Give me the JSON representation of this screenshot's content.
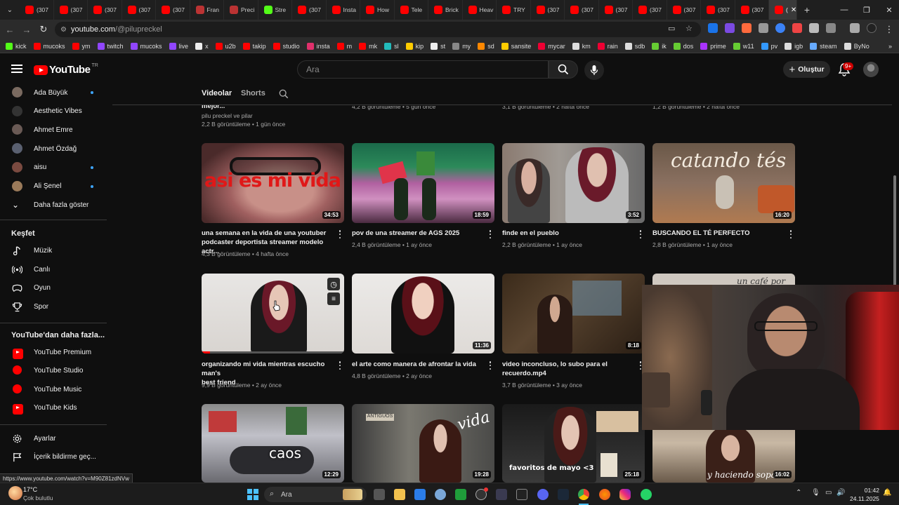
{
  "browser": {
    "tabs": [
      {
        "label": "(307",
        "color": "#ff0000"
      },
      {
        "label": "(307",
        "color": "#ff0000"
      },
      {
        "label": "(307",
        "color": "#ff0000"
      },
      {
        "label": "(307",
        "color": "#ff0000"
      },
      {
        "label": "(307",
        "color": "#ff0000"
      },
      {
        "label": "Fran",
        "color": "#b33"
      },
      {
        "label": "Preci",
        "color": "#b33"
      },
      {
        "label": "Stre",
        "color": "#53fc18"
      },
      {
        "label": "(307",
        "color": "#ff0000"
      },
      {
        "label": "Insta",
        "color": "#ff0000"
      },
      {
        "label": "How",
        "color": "#ff0000"
      },
      {
        "label": "Tele",
        "color": "#ff0000"
      },
      {
        "label": "Brick",
        "color": "#ff0000"
      },
      {
        "label": "Heav",
        "color": "#ff0000"
      },
      {
        "label": "TRY",
        "color": "#ff0000"
      },
      {
        "label": "(307",
        "color": "#ff0000"
      },
      {
        "label": "(307",
        "color": "#ff0000"
      },
      {
        "label": "(307",
        "color": "#ff0000"
      },
      {
        "label": "(307",
        "color": "#ff0000"
      },
      {
        "label": "(307",
        "color": "#ff0000"
      },
      {
        "label": "(307",
        "color": "#ff0000"
      },
      {
        "label": "(307",
        "color": "#ff0000"
      }
    ],
    "active_tab": {
      "label": "(",
      "close": "✕"
    },
    "new_tab": "+",
    "url_host": "youtube.com",
    "url_path": "/@pilupreckel",
    "bookmarks": [
      {
        "label": "kick",
        "color": "#53fc18"
      },
      {
        "label": "mucoks",
        "color": "#ff0000"
      },
      {
        "label": "ym",
        "color": "#ff0000"
      },
      {
        "label": "twitch",
        "color": "#9146ff"
      },
      {
        "label": "mucoks",
        "color": "#9146ff"
      },
      {
        "label": "live",
        "color": "#9146ff"
      },
      {
        "label": "x",
        "color": "#eee"
      },
      {
        "label": "u2b",
        "color": "#ff0000"
      },
      {
        "label": "takip",
        "color": "#ff0000"
      },
      {
        "label": "studio",
        "color": "#ff0000"
      },
      {
        "label": "insta",
        "color": "#e1306c"
      },
      {
        "label": "m",
        "color": "#ff0000"
      },
      {
        "label": "mk",
        "color": "#ff0000"
      },
      {
        "label": "sl",
        "color": "#2bb"
      },
      {
        "label": "kip",
        "color": "#fc0"
      },
      {
        "label": "st",
        "color": "#eee"
      },
      {
        "label": "my",
        "color": "#888"
      },
      {
        "label": "sd",
        "color": "#f80"
      },
      {
        "label": "sansite",
        "color": "#fc0"
      },
      {
        "label": "mycar",
        "color": "#e03"
      },
      {
        "label": "km",
        "color": "#ddd"
      },
      {
        "label": "rain",
        "color": "#e03"
      },
      {
        "label": "sdb",
        "color": "#ddd"
      },
      {
        "label": "ik",
        "color": "#6c3"
      },
      {
        "label": "dos",
        "color": "#6c3"
      },
      {
        "label": "prime",
        "color": "#a3f"
      },
      {
        "label": "w11",
        "color": "#6c3"
      },
      {
        "label": "pv",
        "color": "#39f"
      },
      {
        "label": "igb",
        "color": "#ddd"
      },
      {
        "label": "steam",
        "color": "#6af"
      },
      {
        "label": "ByNo",
        "color": "#ddd"
      }
    ],
    "bookmarks_more": "»",
    "status_url": "https://www.youtube.com/watch?v=M90Z81zdNVw"
  },
  "youtube": {
    "logo_text": "YouTube",
    "logo_region": "TR",
    "search_placeholder": "Ara",
    "create_label": "Oluştur",
    "notif_badge": "9+"
  },
  "sidebar": {
    "subscriptions": [
      {
        "label": "Ada Büyük",
        "dot": true,
        "color": "#7a6a60"
      },
      {
        "label": "Aesthetic Vibes",
        "dot": false,
        "color": "#333"
      },
      {
        "label": "Ahmet Emre",
        "dot": false,
        "color": "#6a5a55"
      },
      {
        "label": "Ahmet Özdağ",
        "dot": false,
        "color": "#5a6070"
      },
      {
        "label": "aisu",
        "dot": true,
        "color": "#7a4a40"
      },
      {
        "label": "Ali Şenel",
        "dot": true,
        "color": "#9a7a5a"
      }
    ],
    "show_more": "Daha fazla göster",
    "explore_title": "Keşfet",
    "explore": [
      {
        "label": "Müzik",
        "icon": "music-note-icon"
      },
      {
        "label": "Canlı",
        "icon": "live-icon"
      },
      {
        "label": "Oyun",
        "icon": "gamepad-icon"
      },
      {
        "label": "Spor",
        "icon": "trophy-icon"
      }
    ],
    "more_title": "YouTube'dan daha fazla...",
    "more": [
      {
        "label": "YouTube Premium"
      },
      {
        "label": "YouTube Studio"
      },
      {
        "label": "YouTube Music"
      },
      {
        "label": "YouTube Kids"
      }
    ],
    "settings": "Ayarlar",
    "report": "İçerik bildirme geç..."
  },
  "channel_tabs": {
    "videos": "Videolar",
    "shorts": "Shorts"
  },
  "top_partial_row": {
    "col1_title": "mejor...",
    "col1_channel": "pilu preckel ve pilar",
    "col1_meta": "2,2 B görüntüleme • 1 gün önce",
    "col2_meta": "4,2 B görüntüleme • 5 gün önce",
    "col3_meta": "3,1 B görüntüleme • 2 hafta önce",
    "col4_meta": "1,2 B görüntüleme • 2 hafta önce"
  },
  "videos": [
    {
      "title_1": "una semana en la vida de una youtuber",
      "title_2": "podcaster deportista streamer modelo actr...",
      "meta": "4,3 B görüntüleme • 4 hafta önce",
      "duration": "34:53",
      "overlay": "asi es mi vida"
    },
    {
      "title_1": "pov de una streamer de AGS 2025",
      "title_2": "",
      "meta": "2,4 B görüntüleme • 1 ay önce",
      "duration": "18:59",
      "overlay": ""
    },
    {
      "title_1": "finde en el pueblo",
      "title_2": "",
      "meta": "2,2 B görüntüleme • 1 ay önce",
      "duration": "3:52",
      "overlay": ""
    },
    {
      "title_1": "BUSCANDO EL TÉ PERFECTO",
      "title_2": "",
      "meta": "2,8 B görüntüleme • 1 ay önce",
      "duration": "16:20",
      "overlay": "catando tés"
    },
    {
      "title_1": "organizando mi vida mientras escucho man's",
      "title_2": "best friend",
      "meta": "9,9 B görüntüleme • 2 ay önce",
      "duration": "",
      "overlay": ""
    },
    {
      "title_1": "el arte como manera de afrontar la vida",
      "title_2": "",
      "meta": "4,8 B görüntüleme • 2 ay önce",
      "duration": "11:36",
      "overlay": ""
    },
    {
      "title_1": "video inconcluso, lo subo para el",
      "title_2": "recuerdo.mp4",
      "meta": "3,7 B görüntüleme • 3 ay önce",
      "duration": "8:18",
      "overlay": ""
    },
    {
      "title_1": "",
      "title_2": "",
      "meta": "",
      "duration": "",
      "overlay": "un café por"
    },
    {
      "title_1": "",
      "title_2": "",
      "meta": "",
      "duration": "12:29",
      "overlay": "caos"
    },
    {
      "title_1": "",
      "title_2": "",
      "meta": "",
      "duration": "19:28",
      "overlay": "vida"
    },
    {
      "title_1": "",
      "title_2": "",
      "meta": "",
      "duration": "25:18",
      "overlay": "favoritos de mayo <3"
    },
    {
      "title_1": "",
      "title_2": "",
      "meta": "",
      "duration": "16:02",
      "overlay": "y haciendo sopa"
    }
  ],
  "taskbar": {
    "weather_temp": "17°C",
    "weather_desc": "Çok bulutlu",
    "search": "Ara",
    "time": "01:42",
    "date": "24.11.2025"
  },
  "colors": {
    "yt_red": "#ff0000",
    "link_blue": "#3ea6ff"
  }
}
